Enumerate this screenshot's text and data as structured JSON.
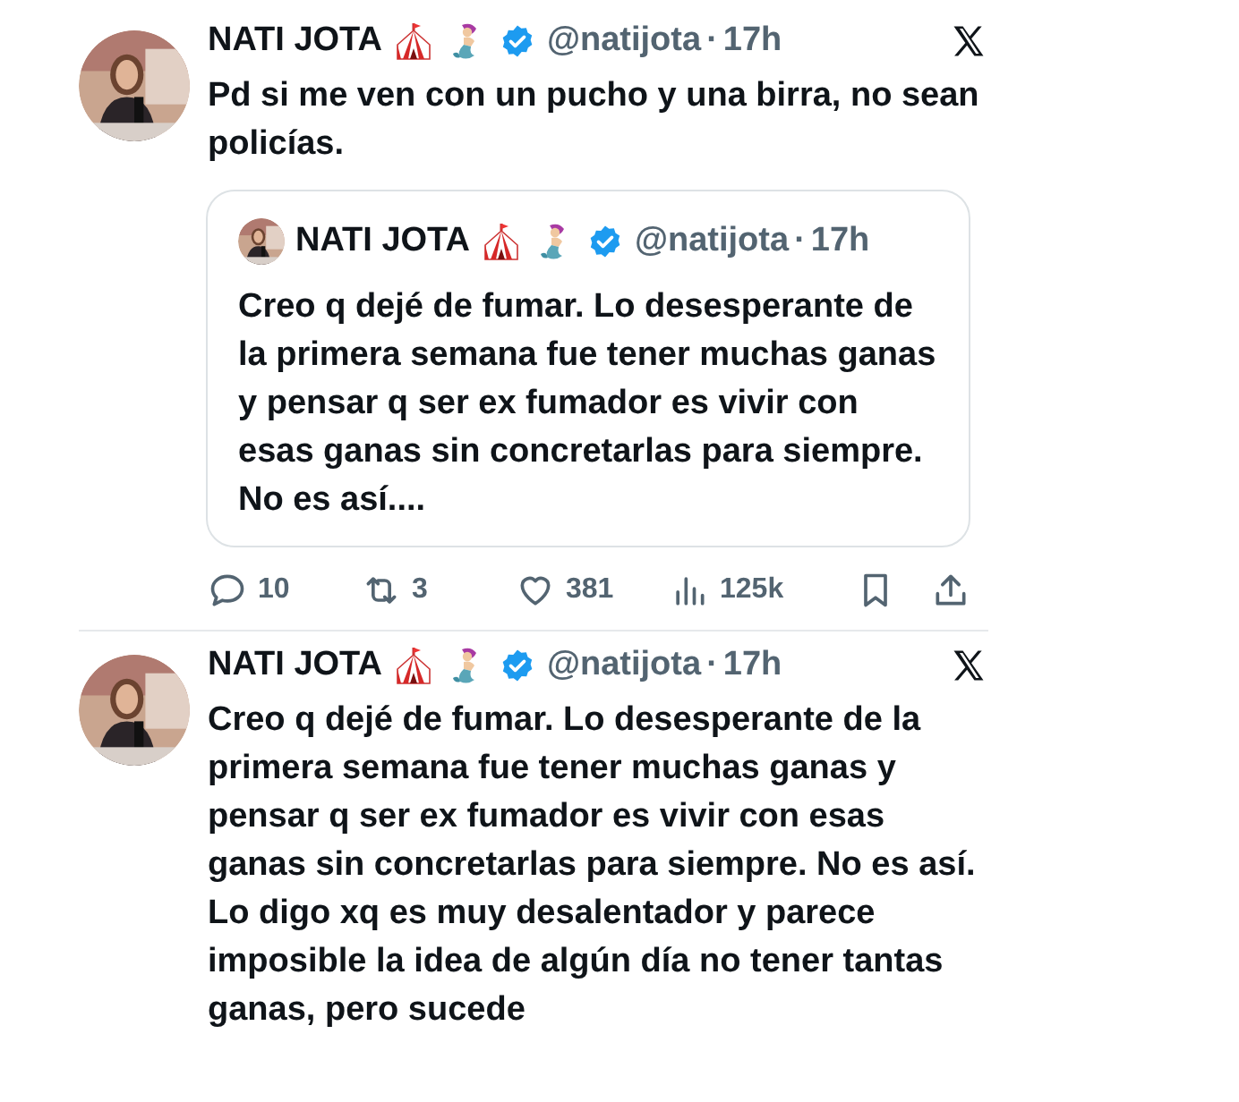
{
  "tweets": [
    {
      "author": {
        "name": "NATI JOTA",
        "handle": "@natijota",
        "separator": "·",
        "time": "17h",
        "verified": true
      },
      "text": "Pd si me ven con un pucho y una birra, no sean policías.",
      "quote": {
        "author": {
          "name": "NATI JOTA",
          "handle": "@natijota",
          "separator": "·",
          "time": "17h",
          "verified": true
        },
        "text": "Creo q dejé de fumar. Lo desesperante de la primera semana fue tener muchas ganas y pensar q ser ex fumador es vivir con esas ganas sin concretarlas para siempre. No es así...."
      },
      "actions": [
        {
          "kind": "reply",
          "count": "10"
        },
        {
          "kind": "repost",
          "count": "3"
        },
        {
          "kind": "like",
          "count": "381"
        },
        {
          "kind": "views",
          "count": "125k"
        },
        {
          "kind": "bookmark"
        },
        {
          "kind": "share"
        }
      ]
    },
    {
      "author": {
        "name": "NATI JOTA",
        "handle": "@natijota",
        "separator": "·",
        "time": "17h",
        "verified": true
      },
      "text": "Creo q dejé de fumar. Lo desesperante de la primera semana fue tener muchas ganas y pensar q ser ex fumador es vivir con esas ganas sin concretarlas para siempre. No es así. Lo digo xq es muy desalentador y parece imposible la idea de algún día no tener tantas ganas, pero sucede"
    }
  ]
}
